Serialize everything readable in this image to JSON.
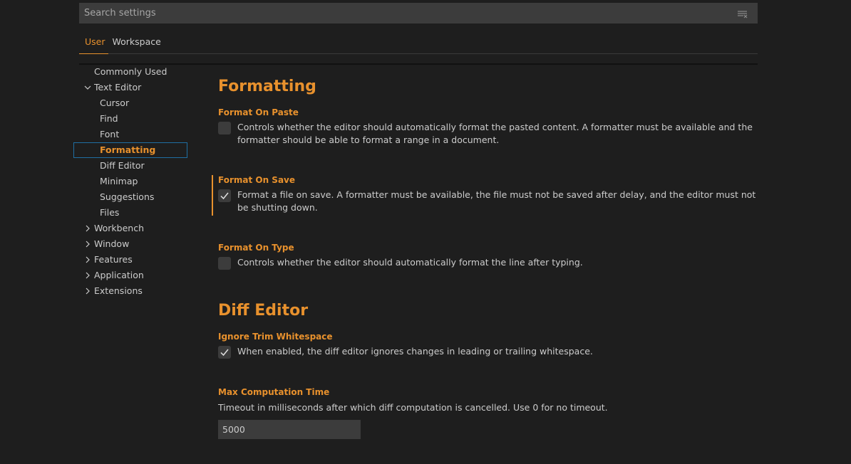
{
  "search": {
    "placeholder": "Search settings",
    "value": ""
  },
  "tabs": [
    {
      "label": "User"
    },
    {
      "label": "Workspace"
    }
  ],
  "toc": [
    {
      "label": "Commonly Used"
    },
    {
      "label": "Text Editor"
    },
    {
      "label": "Cursor"
    },
    {
      "label": "Find"
    },
    {
      "label": "Font"
    },
    {
      "label": "Formatting"
    },
    {
      "label": "Diff Editor"
    },
    {
      "label": "Minimap"
    },
    {
      "label": "Suggestions"
    },
    {
      "label": "Files"
    },
    {
      "label": "Workbench"
    },
    {
      "label": "Window"
    },
    {
      "label": "Features"
    },
    {
      "label": "Application"
    },
    {
      "label": "Extensions"
    }
  ],
  "sections": {
    "formatting": {
      "title": "Formatting",
      "format_on_paste": {
        "title": "Format On Paste",
        "checked": false,
        "description": "Controls whether the editor should automatically format the pasted content. A formatter must be available and the formatter should be able to format a range in a document."
      },
      "format_on_save": {
        "title": "Format On Save",
        "checked": true,
        "description": "Format a file on save. A formatter must be available, the file must not be saved after delay, and the editor must not be shutting down."
      },
      "format_on_type": {
        "title": "Format On Type",
        "checked": false,
        "description": "Controls whether the editor should automatically format the line after typing."
      }
    },
    "diff_editor": {
      "title": "Diff Editor",
      "ignore_trim_whitespace": {
        "title": "Ignore Trim Whitespace",
        "checked": true,
        "description": "When enabled, the diff editor ignores changes in leading or trailing whitespace."
      },
      "max_computation_time": {
        "title": "Max Computation Time",
        "description": "Timeout in milliseconds after which diff computation is cancelled. Use 0 for no timeout.",
        "value": "5000"
      }
    }
  },
  "colors": {
    "accent": "#e8912d",
    "background": "#1e1e1e",
    "input": "#3c3c3c",
    "focus_border": "#1f6fa3"
  }
}
